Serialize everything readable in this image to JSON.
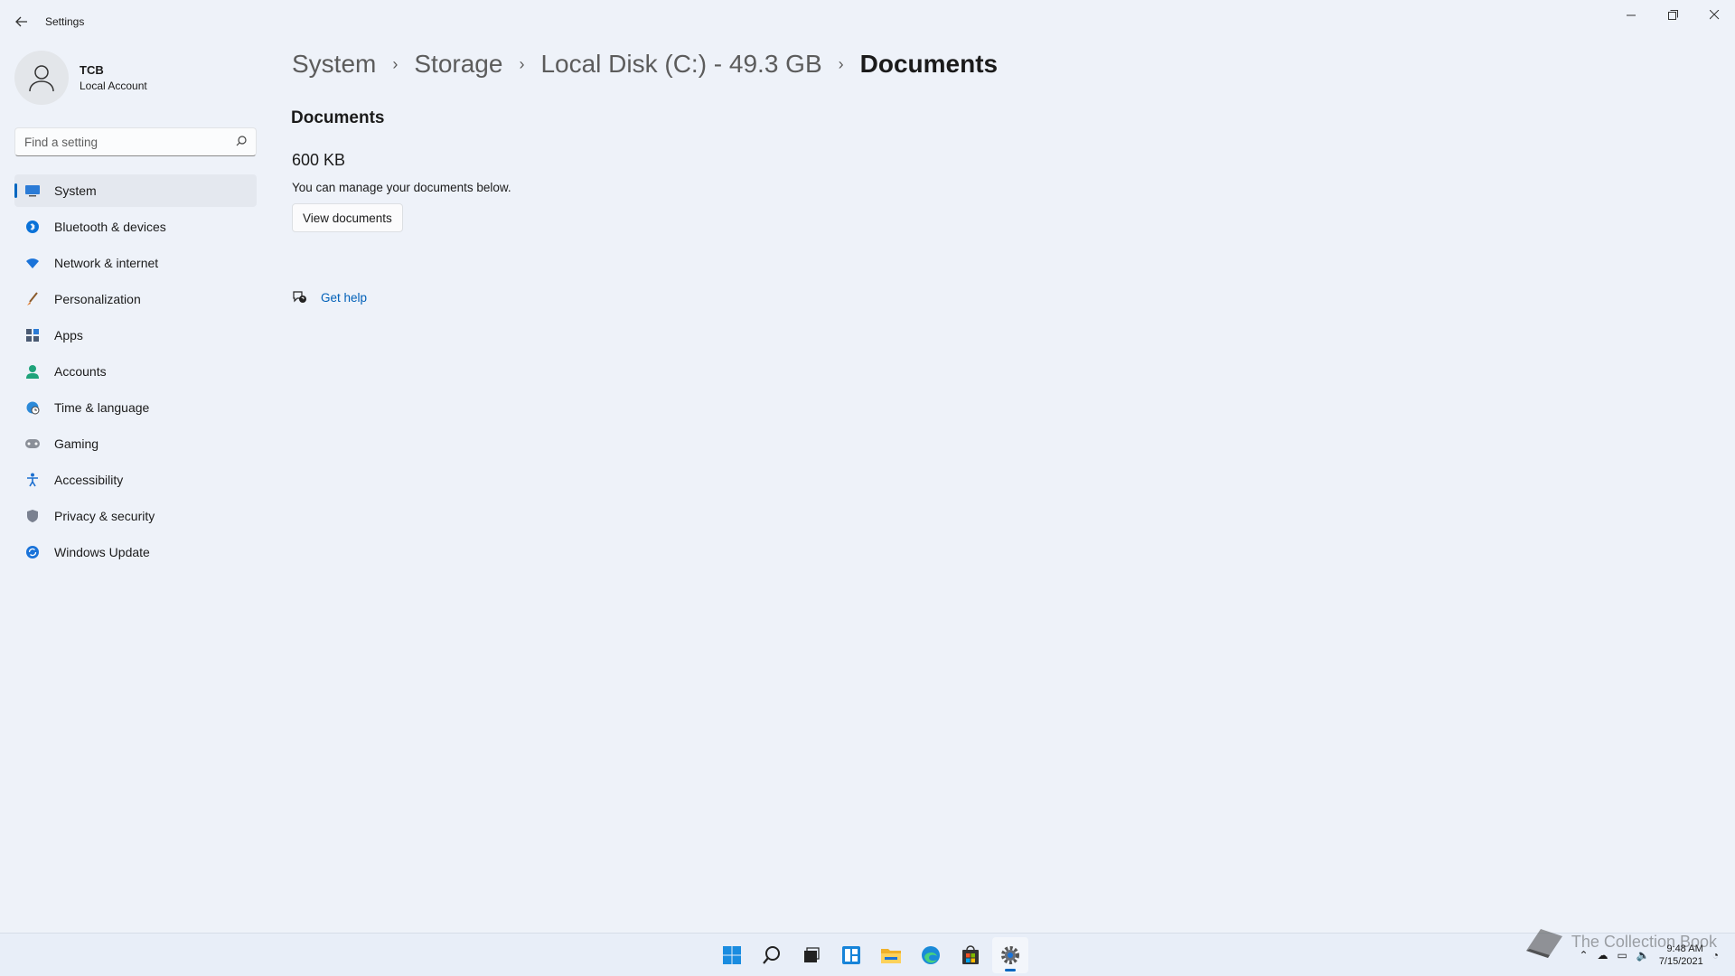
{
  "window": {
    "title": "Settings"
  },
  "user": {
    "name": "TCB",
    "account_type": "Local Account"
  },
  "search": {
    "placeholder": "Find a setting"
  },
  "sidebar": {
    "items": [
      {
        "label": "System",
        "icon": "system-icon",
        "active": true
      },
      {
        "label": "Bluetooth & devices",
        "icon": "bluetooth-icon"
      },
      {
        "label": "Network & internet",
        "icon": "wifi-icon"
      },
      {
        "label": "Personalization",
        "icon": "brush-icon"
      },
      {
        "label": "Apps",
        "icon": "apps-icon"
      },
      {
        "label": "Accounts",
        "icon": "accounts-icon"
      },
      {
        "label": "Time & language",
        "icon": "globe-clock-icon"
      },
      {
        "label": "Gaming",
        "icon": "gamepad-icon"
      },
      {
        "label": "Accessibility",
        "icon": "accessibility-icon"
      },
      {
        "label": "Privacy & security",
        "icon": "shield-icon"
      },
      {
        "label": "Windows Update",
        "icon": "update-icon"
      }
    ]
  },
  "breadcrumb": [
    "System",
    "Storage",
    "Local Disk (C:) - 49.3 GB",
    "Documents"
  ],
  "main": {
    "section_title": "Documents",
    "size": "600 KB",
    "description": "You can manage your documents below.",
    "view_button": "View documents",
    "help_link": "Get help"
  },
  "taskbar": {
    "apps": [
      "start-icon",
      "search-icon",
      "task-view-icon",
      "widgets-icon",
      "file-explorer-icon",
      "edge-icon",
      "store-icon",
      "settings-icon"
    ],
    "active_app": "settings-icon"
  },
  "tray": {
    "time": "9:48 AM",
    "date": "7/15/2021"
  },
  "watermark": "The Collection Book",
  "colors": {
    "accent": "#0067c0",
    "link": "#0060b8",
    "background": "#eef2f9"
  }
}
